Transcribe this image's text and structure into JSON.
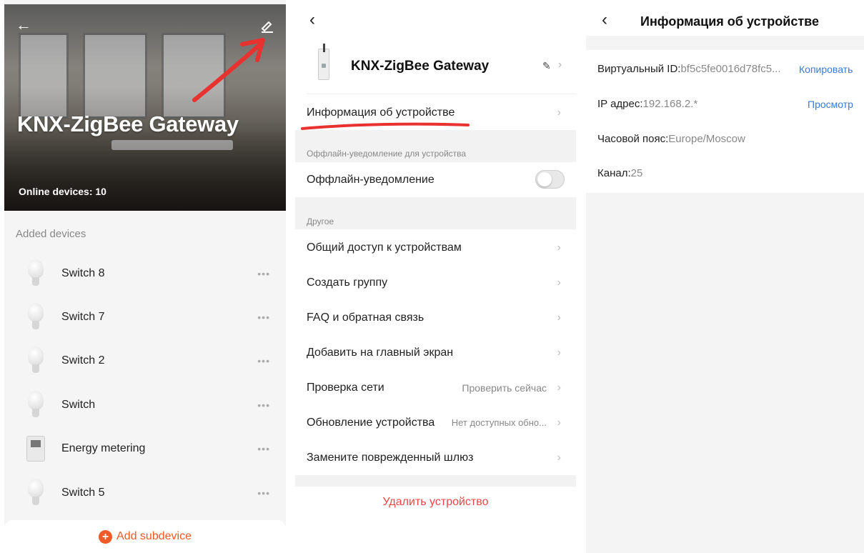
{
  "panel1": {
    "title": "KNX-ZigBee Gateway",
    "online": "Online devices: 10",
    "added_label": "Added devices",
    "devices": [
      {
        "name": "Switch 8",
        "icon": "bulb-icon"
      },
      {
        "name": "Switch 7",
        "icon": "bulb-icon"
      },
      {
        "name": "Switch 2",
        "icon": "bulb-icon"
      },
      {
        "name": "Switch",
        "icon": "bulb-icon"
      },
      {
        "name": "Energy metering",
        "icon": "meter-icon"
      },
      {
        "name": "Switch 5",
        "icon": "bulb-icon"
      }
    ],
    "more": "•••",
    "add_label": "Add subdevice",
    "accent": "#f05a28"
  },
  "panel2": {
    "title": "KNX-ZigBee Gateway",
    "device_info": "Информация об устройстве",
    "offline_section": "Оффлайн-уведомление для устройства",
    "offline_label": "Оффлайн-уведомление",
    "other_section": "Другое",
    "rows": [
      {
        "label": "Общий доступ к устройствам",
        "value": ""
      },
      {
        "label": "Создать группу",
        "value": ""
      },
      {
        "label": "FAQ и обратная связь",
        "value": ""
      },
      {
        "label": "Добавить на главный экран",
        "value": ""
      },
      {
        "label": "Проверка сети",
        "value": "Проверить сейчас"
      },
      {
        "label": "Обновление устройства",
        "value": "Нет доступных обно..."
      },
      {
        "label": "Замените поврежденный шлюз",
        "value": ""
      }
    ],
    "delete_label": "Удалить устройство",
    "delete_color": "#e84848"
  },
  "panel3": {
    "title": "Информация об устройстве",
    "virtual_id_label": "Виртуальный ID:",
    "virtual_id_value": "bf5c5fe0016d78fc5...",
    "copy_label": "Копировать",
    "ip_label": "IP адрес:",
    "ip_value": "192.168.2.*",
    "view_label": "Просмотр",
    "tz_label": "Часовой пояс:",
    "tz_value": "Europe/Moscow",
    "channel_label": "Канал:",
    "channel_value": "25",
    "link_color": "#3a7bd5"
  }
}
